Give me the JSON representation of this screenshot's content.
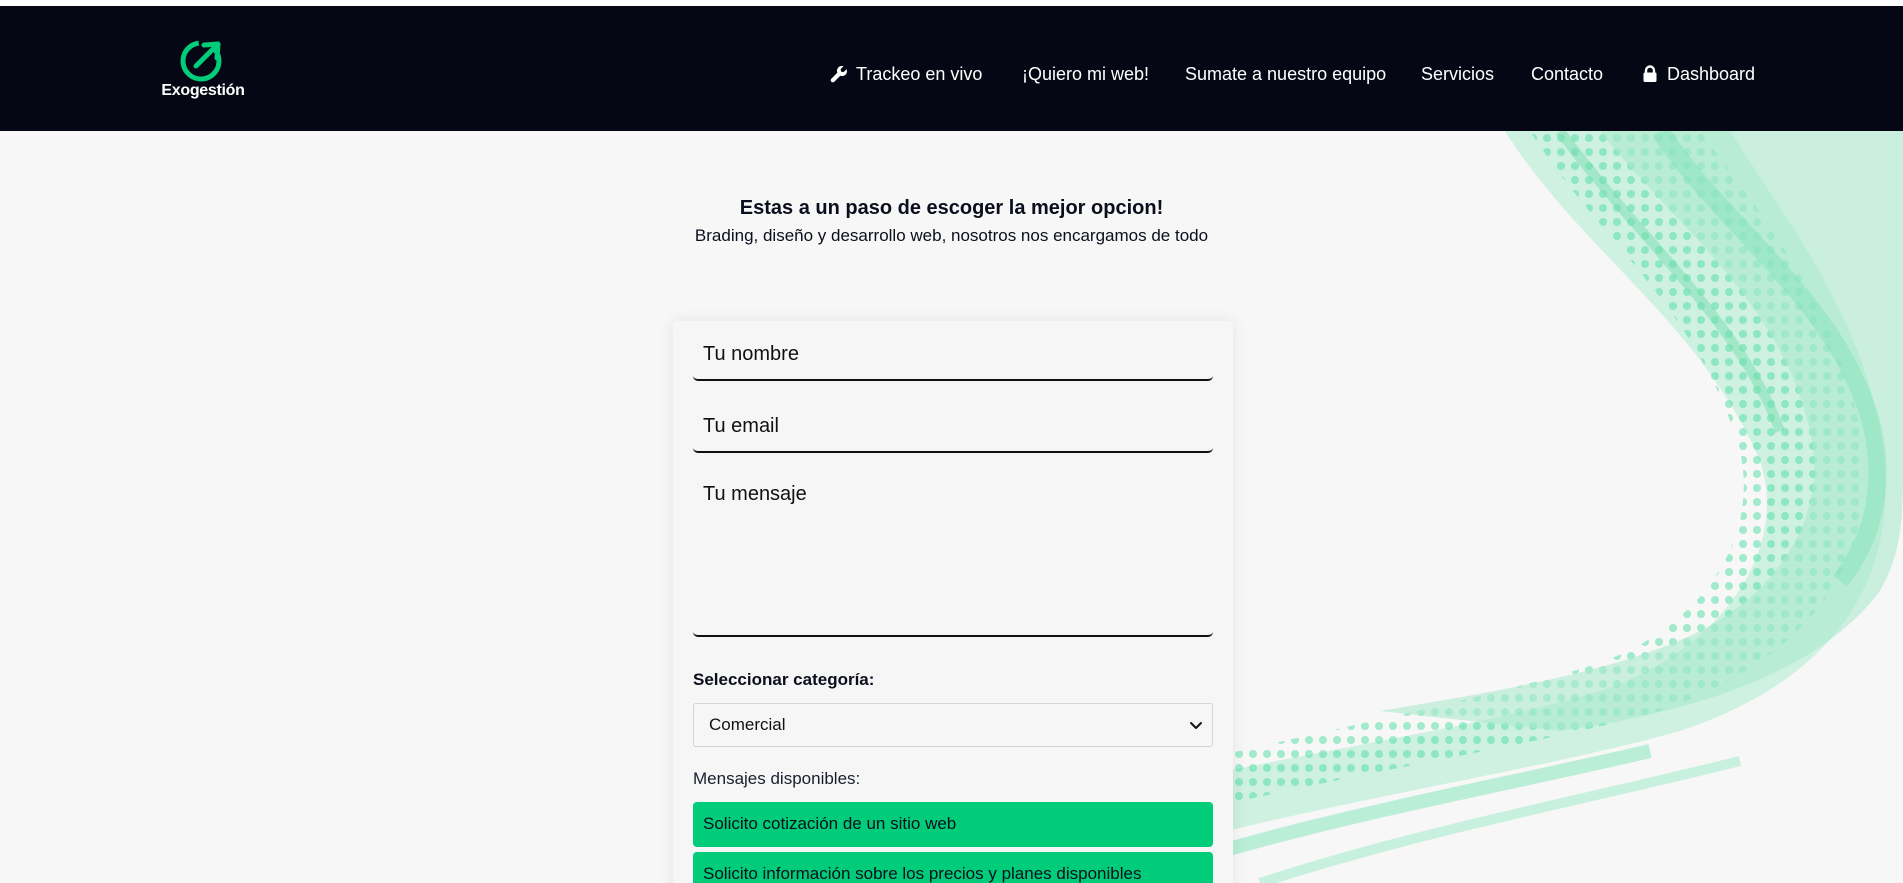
{
  "brand": {
    "name": "Exogestión",
    "accent_color": "#00cc7a",
    "nav_background": "#050814"
  },
  "nav": {
    "items": [
      {
        "label": "Trackeo en vivo",
        "icon": "wrench-icon"
      },
      {
        "label": "¡Quiero mi web!"
      },
      {
        "label": "Sumate a nuestro equipo"
      },
      {
        "label": "Servicios"
      },
      {
        "label": "Contacto"
      },
      {
        "label": "Dashboard",
        "icon": "lock-icon"
      }
    ]
  },
  "hero": {
    "title": "Estas a un paso de escoger la mejor opcion!",
    "subtitle": "Brading, diseño y desarrollo web, nosotros nos encargamos de todo"
  },
  "form": {
    "name_placeholder": "Tu nombre",
    "email_placeholder": "Tu email",
    "message_placeholder": "Tu mensaje",
    "category_label": "Seleccionar categoría:",
    "category_selected": "Comercial",
    "messages_label": "Mensajes disponibles:",
    "messages": [
      "Solicito cotización de un sitio web",
      "Solicito información sobre los precios y planes disponibles"
    ]
  }
}
